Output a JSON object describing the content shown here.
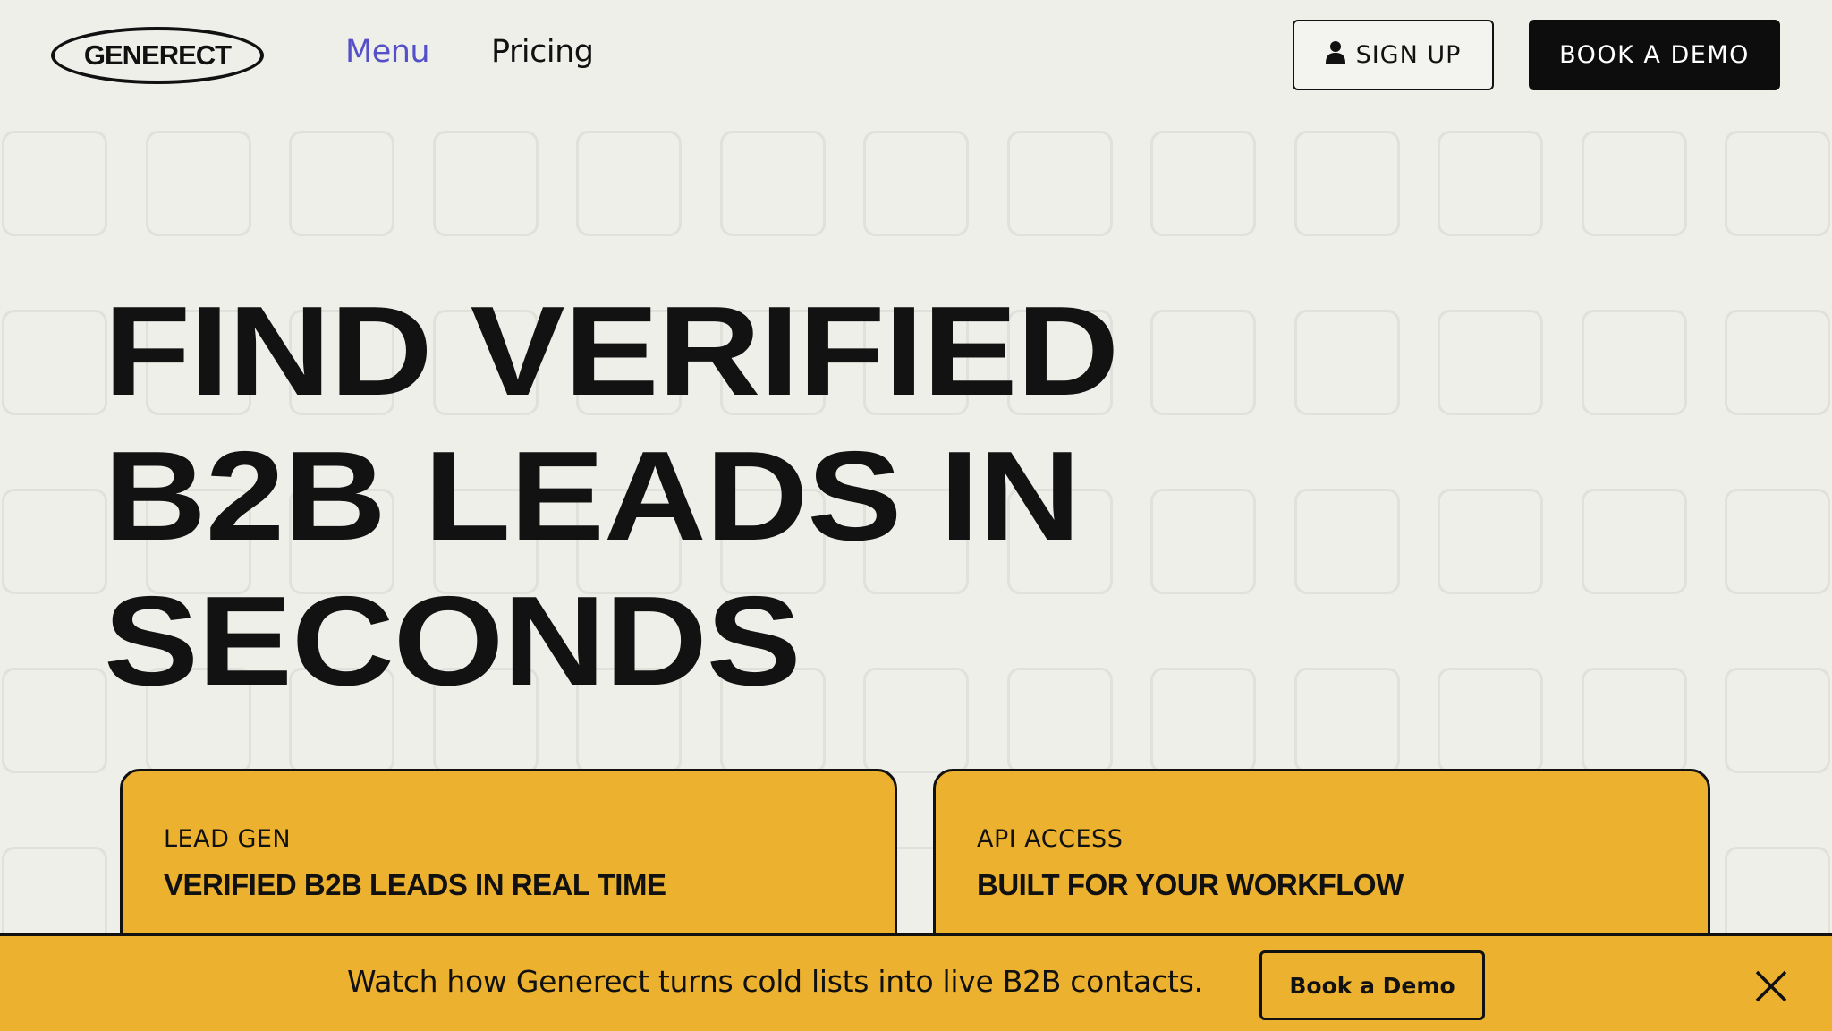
{
  "header": {
    "logo": "GENERECT",
    "nav": [
      {
        "label": "Menu",
        "color": "#5650c8"
      },
      {
        "label": "Pricing",
        "color": "#111111"
      }
    ],
    "signup_label": "SIGN UP",
    "signup_icon": "user-icon",
    "demo_label": "BOOK A DEMO"
  },
  "hero": {
    "lines": [
      "FIND VERIFIED",
      "B2B LEADS IN",
      "SECONDS"
    ]
  },
  "cards": [
    {
      "tag": "LEAD GEN",
      "headline": "VERIFIED B2B LEADS IN REAL TIME"
    },
    {
      "tag": "API ACCESS",
      "headline": "BUILT FOR YOUR WORKFLOW"
    }
  ],
  "banner": {
    "text": "Watch how Generect turns cold lists into live B2B contacts.",
    "button_label": "Book a Demo",
    "close_icon": "close-icon"
  },
  "colors": {
    "background": "#efefea",
    "accent_yellow": "#ecb12f",
    "menu_purple": "#5650c8",
    "dark": "#0d0d0d"
  }
}
